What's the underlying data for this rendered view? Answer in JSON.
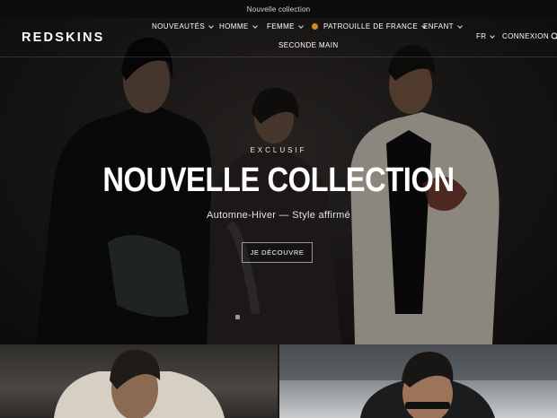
{
  "announcement": {
    "text": "Nouvelle collection"
  },
  "header": {
    "logo": "REDSKINS",
    "nav": [
      {
        "label": "NOUVEAUTÉS"
      },
      {
        "label": "HOMME"
      },
      {
        "label": "FEMME"
      },
      {
        "label": "PATROUILLE DE FRANCE"
      },
      {
        "label": "ENFANT"
      },
      {
        "label": "SECONDE MAIN"
      }
    ],
    "language": "FR",
    "login": "CONNEXION"
  },
  "hero": {
    "eyebrow": "EXCLUSIF",
    "title": "NOUVELLE COLLECTION",
    "subtitle": "Automne-Hiver — Style affirmé",
    "cta": "JE DÉCOUVRE"
  },
  "colors": {
    "accent_dot": "#c8902a",
    "background": "#1a1a1a"
  }
}
